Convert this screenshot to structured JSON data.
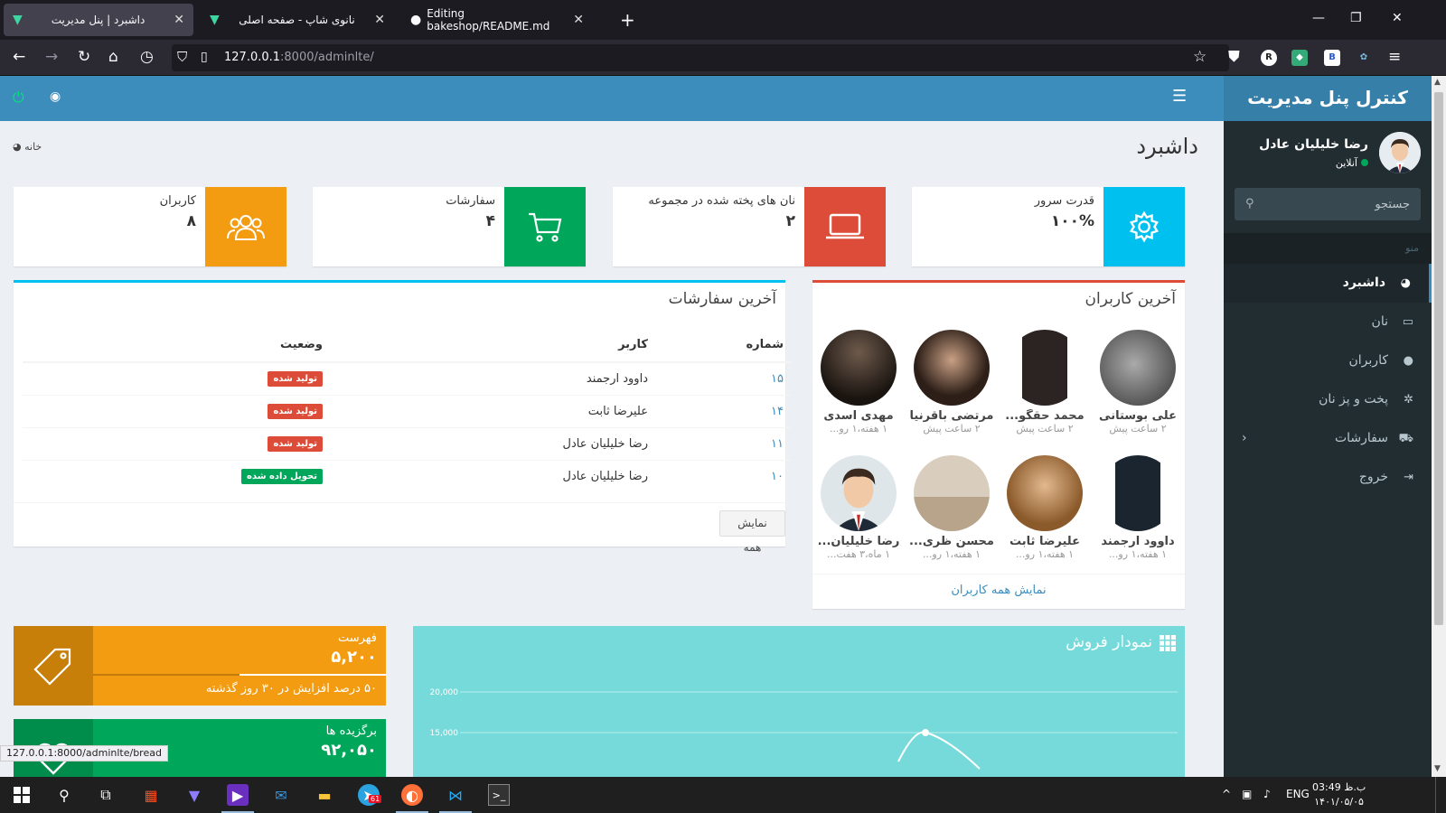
{
  "browser": {
    "tabs": [
      {
        "title": "داشبرد | پنل مدیریت",
        "active": true
      },
      {
        "title": "نانوی شاپ - صفحه اصلی",
        "active": false
      },
      {
        "title": "Editing bakeshop/README.md",
        "active": false
      }
    ],
    "url_host": "127.0.0.1",
    "url_rest": ":8000/adminlte/",
    "status_url": "127.0.0.1:8000/adminlte/bread"
  },
  "admin": {
    "brand": "کنترل پنل مدیریت",
    "user": {
      "name": "رضا خلیلیان عادل",
      "status": "آنلاین"
    },
    "search_placeholder": "جستجو",
    "menu_header": "منو",
    "menu": [
      {
        "label": "داشبرد",
        "icon": "dashboard-icon"
      },
      {
        "label": "نان",
        "icon": "laptop-icon"
      },
      {
        "label": "کاربران",
        "icon": "user-icon"
      },
      {
        "label": "پخت و پز نان",
        "icon": "cogs-icon"
      },
      {
        "label": "سفارشات",
        "icon": "cart-icon"
      },
      {
        "label": "خروج",
        "icon": "sign-out-icon"
      }
    ],
    "page_title": "داشبرد",
    "breadcrumb": "خانه",
    "info_boxes": [
      {
        "label": "قدرت سرور",
        "value": "۱۰۰%",
        "color": "#00c0ef",
        "icon": "gear-icon"
      },
      {
        "label": "نان های پخته شده در مجموعه",
        "value": "۲",
        "color": "#dd4b39",
        "icon": "laptop-icon"
      },
      {
        "label": "سفارشات",
        "value": "۴",
        "color": "#00a65a",
        "icon": "cart-icon"
      },
      {
        "label": "کاربران",
        "value": "۸",
        "color": "#f39c12",
        "icon": "users-icon"
      }
    ],
    "orders": {
      "title": "آخرین سفارشات",
      "headers": [
        "شماره",
        "کاربر",
        "وضعیت"
      ],
      "rows": [
        {
          "id": "۱۵",
          "user": "داوود ارجمند",
          "status": "تولید شده",
          "color": "#dd4b39"
        },
        {
          "id": "۱۴",
          "user": "علیرضا ثابت",
          "status": "تولید شده",
          "color": "#dd4b39"
        },
        {
          "id": "۱۱",
          "user": "رضا خلیلیان عادل",
          "status": "تولید شده",
          "color": "#dd4b39"
        },
        {
          "id": "۱۰",
          "user": "رضا خلیلیان عادل",
          "status": "تحویل داده شده",
          "color": "#00a65a"
        }
      ],
      "view_all": "نمایش همه"
    },
    "latest_users": {
      "title": "آخرین کاربران",
      "users": [
        {
          "name": "علی بوستانی",
          "time": "۲ ساعت پیش"
        },
        {
          "name": "محمد حقگو...",
          "time": "۲ ساعت پیش"
        },
        {
          "name": "مرتضی باقرنیا",
          "time": "۲ ساعت پیش"
        },
        {
          "name": "مهدی اسدی",
          "time": "۱ هفته،۱ رو..."
        },
        {
          "name": "داوود ارجمند",
          "time": "۱ هفته،۱ رو..."
        },
        {
          "name": "علیرضا ثابت",
          "time": "۱ هفته،۱ رو..."
        },
        {
          "name": "محسن ظری...",
          "time": "۱ هفته،۱ رو..."
        },
        {
          "name": "رضا خلیلیان...",
          "time": "۱ ماه،۳ هفت..."
        }
      ],
      "view_all": "نمایش همه کاربران"
    },
    "small_boxes": [
      {
        "label": "فهرست",
        "value": "۵,۲۰۰",
        "desc": "۵۰ درصد افزایش در ۳۰ روز گذشته",
        "progress": 0.5,
        "color": "#f39c12",
        "icon_color": "#c87f0a"
      },
      {
        "label": "برگزیده ها",
        "value": "۹۲,۰۵۰",
        "color": "#00a65a",
        "icon_color": "#008d4c"
      }
    ],
    "chart_title": "نمودار فروش"
  },
  "chart_data": {
    "type": "line",
    "title": "نمودار فروش",
    "y_ticks": [
      "20,000",
      "15,000"
    ],
    "ylim": [
      0,
      20000
    ],
    "series": [
      {
        "values": [
          15000
        ]
      }
    ]
  },
  "taskbar": {
    "time": "03:49 ب.ظ",
    "date": "۱۴۰۱/۰۵/۰۵",
    "lang": "ENG",
    "badge": "61"
  }
}
